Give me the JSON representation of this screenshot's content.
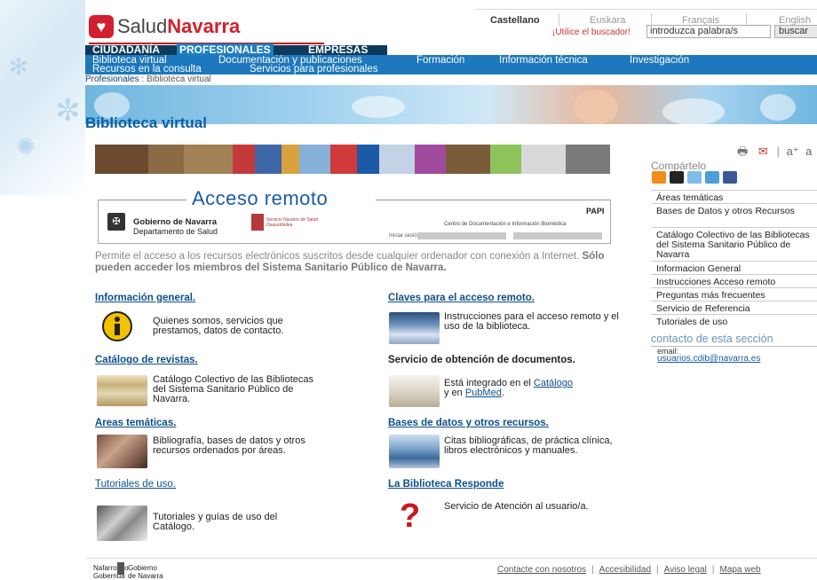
{
  "brand": {
    "part1": "Salud",
    "part2": "Navarra"
  },
  "languages": [
    "Castellano",
    "Euskara",
    "Français",
    "English"
  ],
  "search": {
    "hint": "¡Utilice el buscador!",
    "value": "introduzca palabra/s",
    "button": "buscar"
  },
  "nav_top": [
    "CIUDADANÍA",
    "PROFESIONALES",
    "EMPRESAS"
  ],
  "nav_sub": [
    "Biblioteca virtual",
    "Documentación y publicaciones",
    "Formación",
    "Información técnica",
    "Investigación",
    "Recursos en la consulta",
    "Servicios para profesionales"
  ],
  "breadcrumb": {
    "parent": "Profesionales",
    "separator": " : ",
    "current": "Biblioteca virtual"
  },
  "page_title": "Biblioteca virtual",
  "acceso": {
    "title": "Acceso remoto",
    "gobierno_line1": "Gobierno de Navarra",
    "gobierno_line2": "Departamento de Salud",
    "sns_line1": "Servicio Navarro de Salud",
    "sns_line2": "Osasunbidea",
    "papi": "PAPI",
    "cdib": "Centro de Documentación e Información Biomédica",
    "login_label": "Iniciar sesión"
  },
  "intro": {
    "text": "Permite el acceso a los recursos electrónicos suscritos desde cualquier ordenador con conexión a Internet. ",
    "bold": "Sólo pueden acceder los miembros del Sistema Sanitario Público de Navarra."
  },
  "sections": {
    "info": {
      "title": "Información general.",
      "desc": "Quienes somos, servicios que prestamos, datos de contacto."
    },
    "claves": {
      "title": "Claves para el acceso remoto.",
      "desc": "Instrucciones para el acceso remoto y el uso de la biblioteca."
    },
    "catalogo": {
      "title": "Catálogo de revistas.",
      "desc": "Catálogo Colectivo de las Bibliotecas del Sistema Sanitario Público de Navarra."
    },
    "servicio": {
      "title": "Servicio de obtención de documentos.",
      "desc_pre": "Está integrado en el ",
      "link1": "Catálogo",
      "desc_mid": " y en ",
      "link2": "PubMed",
      "desc_post": "."
    },
    "areas": {
      "title": "Areas temáticas.",
      "desc": "Bibliografía, bases de datos y otros recursos ordenados por áreas."
    },
    "bases": {
      "title": "Bases de datos y otros recursos.",
      "desc": "Citas bibliográficas, de práctica clínica, libros electrónicos y manuales."
    },
    "tutoriales": {
      "title": "Tutoriales de uso.",
      "desc": "Tutoriales y guías de uso del Catálogo."
    },
    "responde": {
      "title": "La Biblioteca Responde",
      "desc": "Servicio de Atención al usuario/a."
    }
  },
  "tools": {
    "font_large": "a⁺",
    "font_small": "a"
  },
  "share_label": "Compártelo",
  "sidebar": [
    "Áreas temáticas",
    "Bases de Datos y otros Recursos",
    "Catálogo Colectivo de las Bibliotecas del Sistema Sanitario Público de Navarra",
    "Informacion General",
    "Instrucciones Acceso remoto",
    "Preguntas más frecuentes",
    "Servicio de Referencia",
    "Tutoriales de uso"
  ],
  "contacto": {
    "title": "contacto de esta sección",
    "email_label": "email:",
    "email": "usuarios.cdib@navarra.es"
  },
  "footer": {
    "gov_left_1": "Nafarroako",
    "gov_left_2": "Gobernua",
    "gov_right_1": "Gobierno",
    "gov_right_2": "de Navarra",
    "links": [
      "Contacte con nosotros",
      "Accesibilidad",
      "Aviso legal",
      "Mapa web"
    ]
  }
}
